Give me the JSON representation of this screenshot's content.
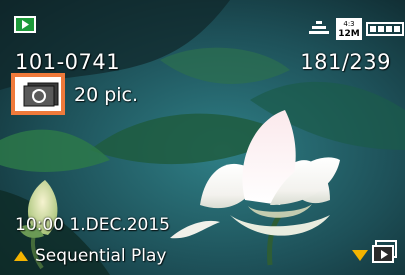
{
  "file_number": "101-0741",
  "frame_counter": "181/239",
  "burst": {
    "count_text": "20 pic.",
    "icon": "burst-group-icon"
  },
  "date_time": "10:00  1.DEC.2015",
  "playback": {
    "sequential_label": "Sequential Play",
    "mode_icon": "playback-mode-icon"
  },
  "icons": {
    "quality": "quality-icon",
    "size": "aspect-ratio-12m-icon",
    "battery": "battery-icon",
    "up_arrow": "up-arrow-icon",
    "down_arrow": "down-arrow-icon",
    "thumbnail": "group-thumbnail-icon"
  },
  "size_label": {
    "ratio": "4:3",
    "mp": "12M"
  },
  "colors": {
    "play_icon_green": "#1d9a3a",
    "highlight_orange": "#ef7a3b",
    "arrow_yellow": "#f4b400"
  }
}
